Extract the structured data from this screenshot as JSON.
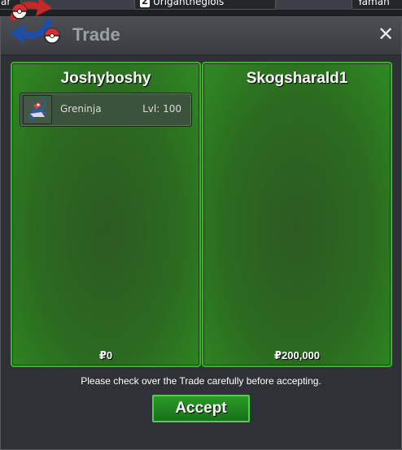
{
  "background_strip": {
    "left_chip": "ar",
    "mid_chip": "Uriganthegiols",
    "right_chip": "Yaman"
  },
  "window": {
    "title": "Trade",
    "close_glyph": "✕"
  },
  "left_panel": {
    "trainer": "Joshyboshy",
    "pokemon": [
      {
        "name": "Greninja",
        "level": "Lvl: 100",
        "icon": "greninja-sprite-icon"
      }
    ],
    "money": "₽0"
  },
  "right_panel": {
    "trainer": "Skogsharald1",
    "pokemon": [],
    "money": "₽200,000"
  },
  "notice": "Please check over the Trade carefully before accepting.",
  "accept_label": "Accept",
  "colors": {
    "panel_border": "#3fae2c",
    "panel_fill": "#2b6a20",
    "accept_fill": "#1f8a1f",
    "title_text": "#9aa0a6"
  }
}
